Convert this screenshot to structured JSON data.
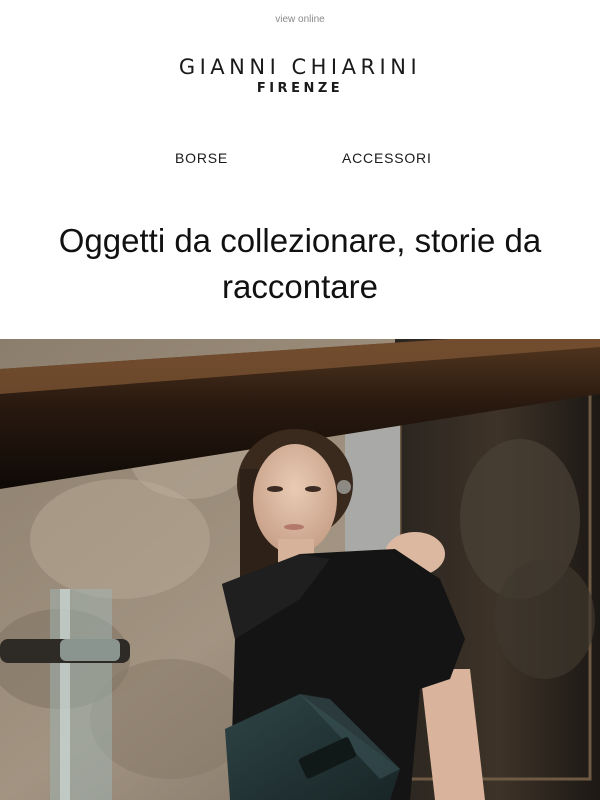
{
  "header": {
    "view_online": "view online",
    "logo_line1": "GIANNI CHIARINI",
    "logo_line2": "FIRENZE"
  },
  "nav": {
    "items": [
      {
        "label": "BORSE"
      },
      {
        "label": "ACCESSORI"
      }
    ]
  },
  "main": {
    "headline": "Oggetti da collezionare, storie da raccontare",
    "hero_image": "model-with-bag-photo"
  },
  "colors": {
    "text": "#111111",
    "muted": "#8a8a8a",
    "background": "#ffffff"
  }
}
